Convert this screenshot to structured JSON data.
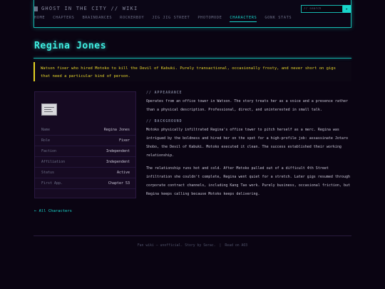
{
  "site": {
    "title": "GHOST IN THE CITY // WIKI"
  },
  "nav": [
    {
      "label": "HOME",
      "active": false
    },
    {
      "label": "CHAPTERS",
      "active": false
    },
    {
      "label": "BRAINDANCES",
      "active": false
    },
    {
      "label": "ROCKERBOY",
      "active": false
    },
    {
      "label": "JIG JIG STREET",
      "active": false
    },
    {
      "label": "PHOTOMODE",
      "active": false
    },
    {
      "label": "CHARACTERS",
      "active": true
    },
    {
      "label": "GONK STATS",
      "active": false
    }
  ],
  "search": {
    "placeholder": "// search",
    "button_icon": "search-arrow-icon"
  },
  "page": {
    "title": "Regina Jones",
    "quote": "Watson fixer who hired Motoko to kill the Devil of Kabuki. Purely transactional, occasionally frosty, and never short on gigs that need a particular kind of person."
  },
  "infobox": {
    "portrait_icon": "character-card-icon",
    "rows": [
      {
        "key": "Name",
        "value": "Regina Jones"
      },
      {
        "key": "Role",
        "value": "Fixer"
      },
      {
        "key": "Faction",
        "value": "Independent"
      },
      {
        "key": "Affiliation",
        "value": "Independent"
      },
      {
        "key": "Status",
        "value": "Active"
      },
      {
        "key": "First App.",
        "value": "Chapter 53"
      }
    ]
  },
  "sections": [
    {
      "heading": "// APPEARANCE",
      "paragraphs": [
        "Operates from an office tower in Watson. The story treats her as a voice and a presence rather than a physical description. Professional, direct, and uninterested in small talk."
      ]
    },
    {
      "heading": "// BACKGROUND",
      "paragraphs": [
        "Motoko physically infiltrated Regina's office tower to pitch herself as a merc. Regina was intrigued by the boldness and hired her on the spot for a high-profile job: assassinate Jotaro Shobo, the Devil of Kabuki. Motoko executed it clean. The success established their working relationship.",
        "The relationship runs hot and cold. After Motoko pulled out of a difficult 4th Street infiltration she couldn't complete, Regina went quiet for a stretch. Later gigs resumed through corporate contract channels, including Kang Tao work. Purely business, occasional friction, but Regina keeps calling because Motoko keeps delivering."
      ]
    }
  ],
  "back_link": "← All Characters",
  "footer": {
    "text": "Fan wiki — unofficial. Story by Serac.",
    "separator": "|",
    "link": "Read on AO3"
  },
  "colors": {
    "background": "#0a0412",
    "accent_cyan": "#18d6cb",
    "accent_yellow": "#e8d72c",
    "panel": "#160a22"
  }
}
